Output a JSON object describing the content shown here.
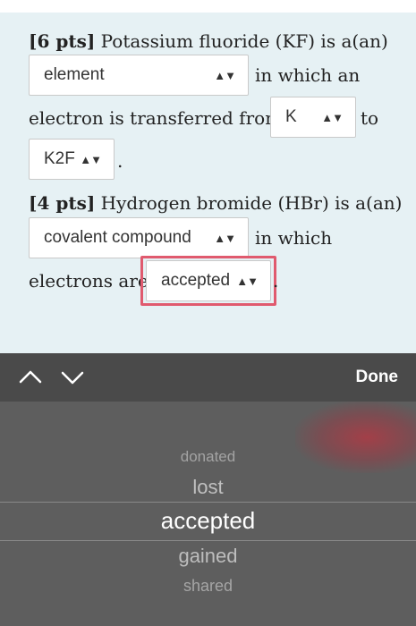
{
  "question1": {
    "points": "[6 pts]",
    "text_a": " Potassium fluoride (KF) is a(an)",
    "select1_value": "element",
    "text_b": "in which an",
    "text_c": "electron is transferred from",
    "select2_value": "K",
    "text_d": "to",
    "select3_value": "K2F",
    "text_e": "."
  },
  "question2": {
    "points": "[4 pts]",
    "text_a": " Hydrogen bromide (HBr) is a(an)",
    "select1_value": "covalent compound",
    "text_b": "in which",
    "text_c": "electrons are",
    "select2_value": "accepted",
    "text_d": "."
  },
  "toolbar": {
    "done_label": "Done",
    "prev_icon": "chevron-up-icon",
    "next_icon": "chevron-down-icon"
  },
  "picker": {
    "options": [
      "donated",
      "lost",
      "accepted",
      "gained",
      "shared"
    ],
    "selected": "accepted"
  },
  "colors": {
    "highlight": "#e05a6e",
    "panel_background": "#e6f1f4",
    "toolbar": "#4a4a4a",
    "picker": "#5e5e5e"
  }
}
